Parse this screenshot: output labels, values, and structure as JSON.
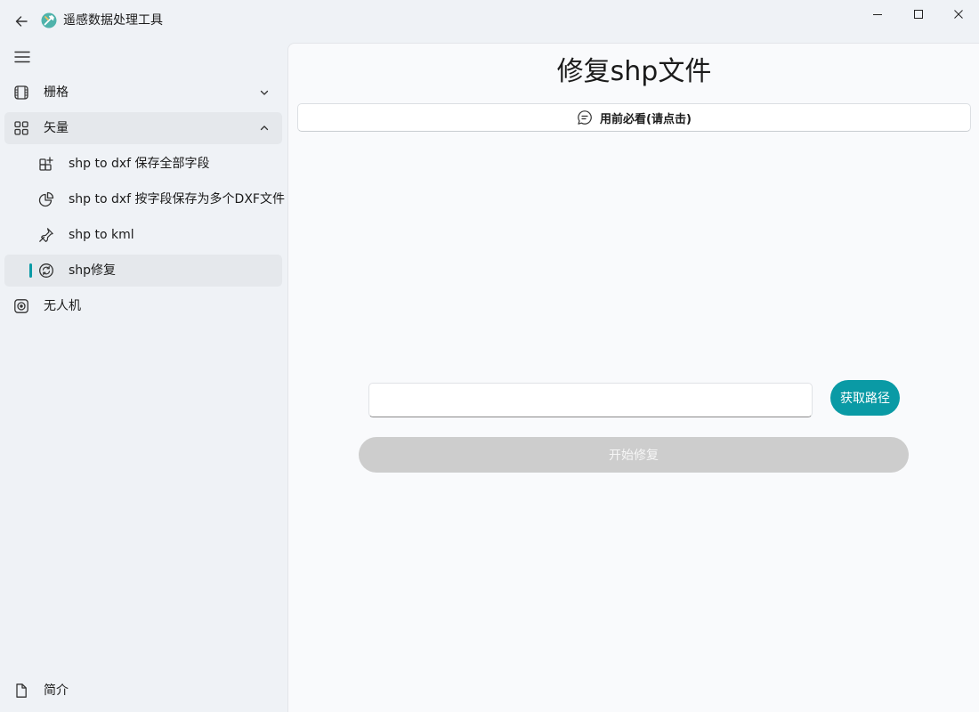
{
  "window": {
    "title": "遥感数据处理工具",
    "controls": [
      "minimize",
      "maximize",
      "close"
    ]
  },
  "sidebar": {
    "items": [
      {
        "label": "栅格",
        "icon": "film-icon",
        "expanded": false
      },
      {
        "label": "矢量",
        "icon": "grid-icon",
        "expanded": true,
        "selected": true
      },
      {
        "label": "shp to dxf 保存全部字段",
        "icon": "apps-add-icon"
      },
      {
        "label": "shp to dxf 按字段保存为多个DXF文件",
        "icon": "pie-chart-icon"
      },
      {
        "label": "shp to kml",
        "icon": "pin-icon"
      },
      {
        "label": "shp修复",
        "icon": "sync-icon",
        "selected": true
      },
      {
        "label": "无人机",
        "icon": "target-icon"
      }
    ],
    "footer": {
      "label": "简介",
      "icon": "document-icon"
    }
  },
  "main": {
    "title": "修复shp文件",
    "notice_button": "用前必看(请点击)",
    "path_input": {
      "value": "",
      "placeholder": ""
    },
    "get_path_button": "获取路径",
    "start_button": "开始修复",
    "start_button_enabled": false
  },
  "colors": {
    "accent": "#0a9aa5",
    "background": "#eff2f6",
    "content_background": "#f9fafc",
    "disabled": "#cdcdcd"
  }
}
